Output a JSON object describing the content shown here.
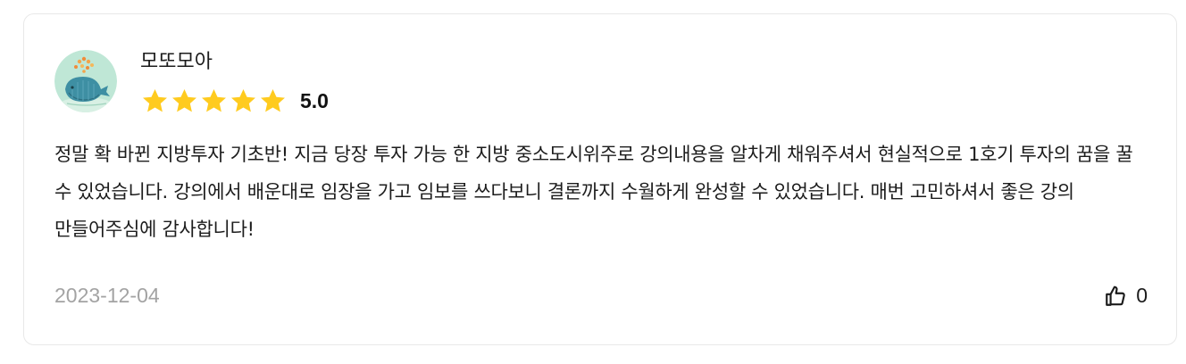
{
  "review": {
    "author": "모또모아",
    "rating_value": "5.0",
    "rating": 5,
    "max_rating": 5,
    "text": "정말 확 바뀐 지방투자 기초반! 지금 당장 투자 가능 한 지방 중소도시위주로 강의내용을 알차게 채워주셔서 현실적으로 1호기 투자의 꿈을 꿀 수 있었습니다. 강의에서 배운대로 임장을 가고 임보를 쓰다보니 결론까지 수월하게 완성할 수 있었습니다. 매번 고민하셔서 좋은 강의 만들어주심에 감사합니다!",
    "date": "2023-12-04",
    "like_count": "0"
  },
  "icons": {
    "avatar": "whale-avatar-icon",
    "star": "star-icon",
    "like": "thumbs-up-icon"
  },
  "colors": {
    "star": "#FFCB1F",
    "date": "#A3A3A3",
    "border": "#E8E8E8",
    "avatar_bg": "#BFE7D6",
    "whale": "#3E8FA3"
  }
}
